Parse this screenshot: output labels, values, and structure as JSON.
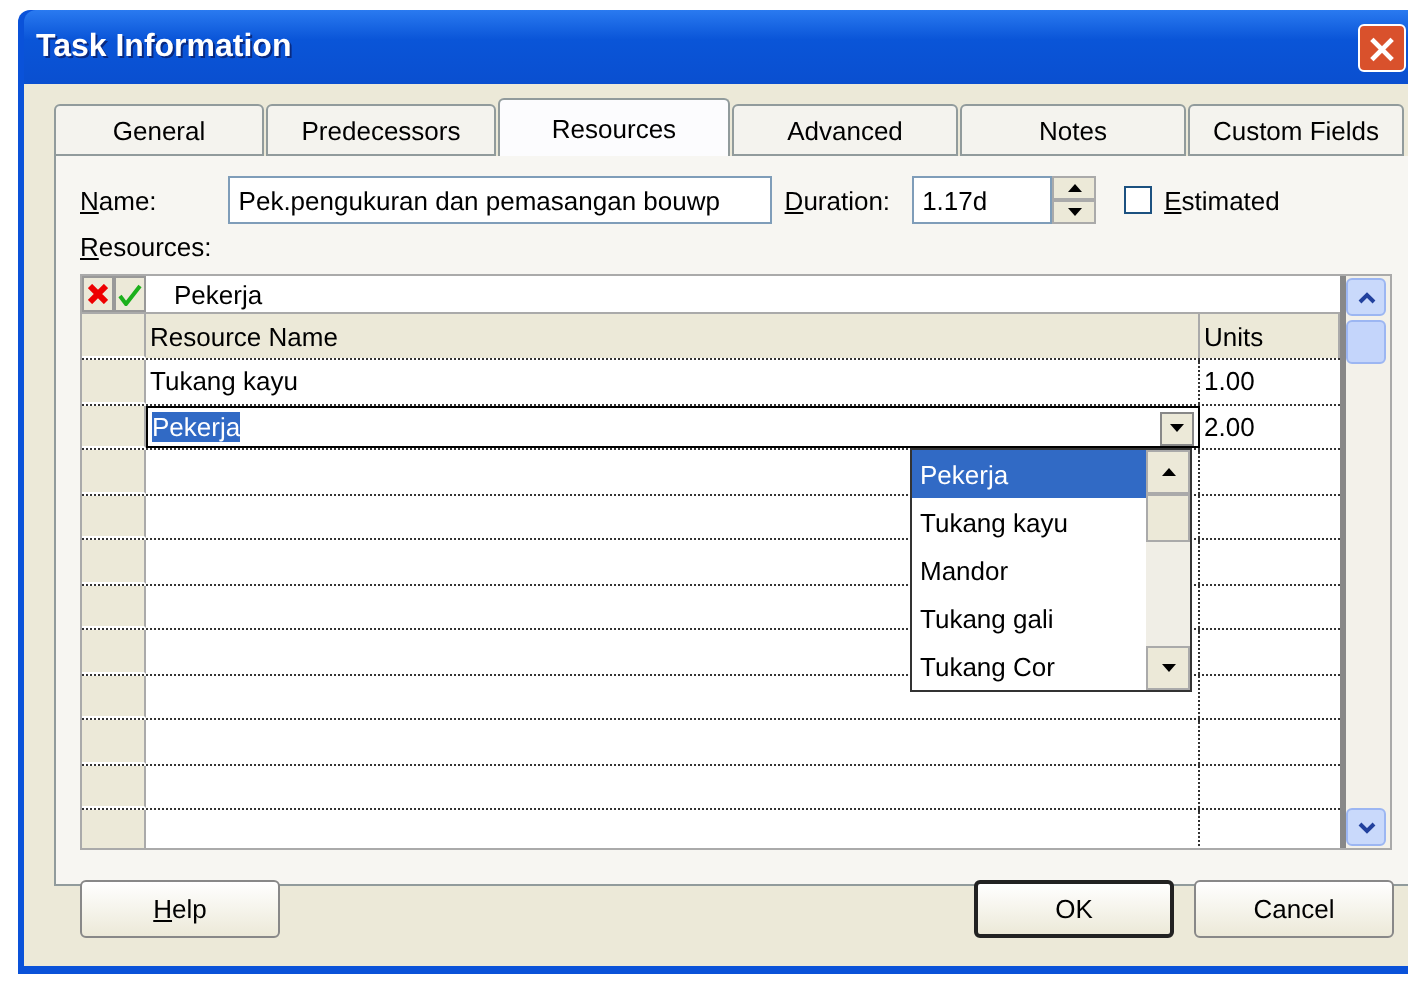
{
  "window": {
    "title": "Task Information",
    "close": "×"
  },
  "tabs": [
    {
      "label": "General",
      "selected": false
    },
    {
      "label": "Predecessors",
      "selected": false
    },
    {
      "label": "Resources",
      "selected": true
    },
    {
      "label": "Advanced",
      "selected": false
    },
    {
      "label": "Notes",
      "selected": false
    },
    {
      "label": "Custom Fields",
      "selected": false
    }
  ],
  "name_field": {
    "label": "Name:",
    "underline_first": true,
    "value": "Pek.pengukuran dan pemasangan bouwp"
  },
  "duration_field": {
    "label": "Duration:",
    "underline_first": true,
    "value": "1.17d"
  },
  "estimated": {
    "label": "Estimated",
    "underline_first": true,
    "checked": false
  },
  "resources": {
    "label": "Resources:",
    "underline_first": true,
    "entry_value": "Pekerja",
    "columns": [
      "Resource Name",
      "Units"
    ],
    "rows": [
      {
        "name": "Tukang kayu",
        "units": "1.00",
        "editing": false
      },
      {
        "name": "Pekerja",
        "units": "2.00",
        "editing": true
      }
    ],
    "dropdown": [
      {
        "label": "Pekerja",
        "selected": true
      },
      {
        "label": "Tukang kayu",
        "selected": false
      },
      {
        "label": "Mandor",
        "selected": false
      },
      {
        "label": "Tukang gali",
        "selected": false
      },
      {
        "label": "Tukang Cor",
        "selected": false
      }
    ]
  },
  "buttons": [
    {
      "label": "Help",
      "underline_first": true,
      "default": false
    },
    {
      "label": "OK",
      "underline_first": false,
      "default": true
    },
    {
      "label": "Cancel",
      "underline_first": false,
      "default": false
    }
  ]
}
